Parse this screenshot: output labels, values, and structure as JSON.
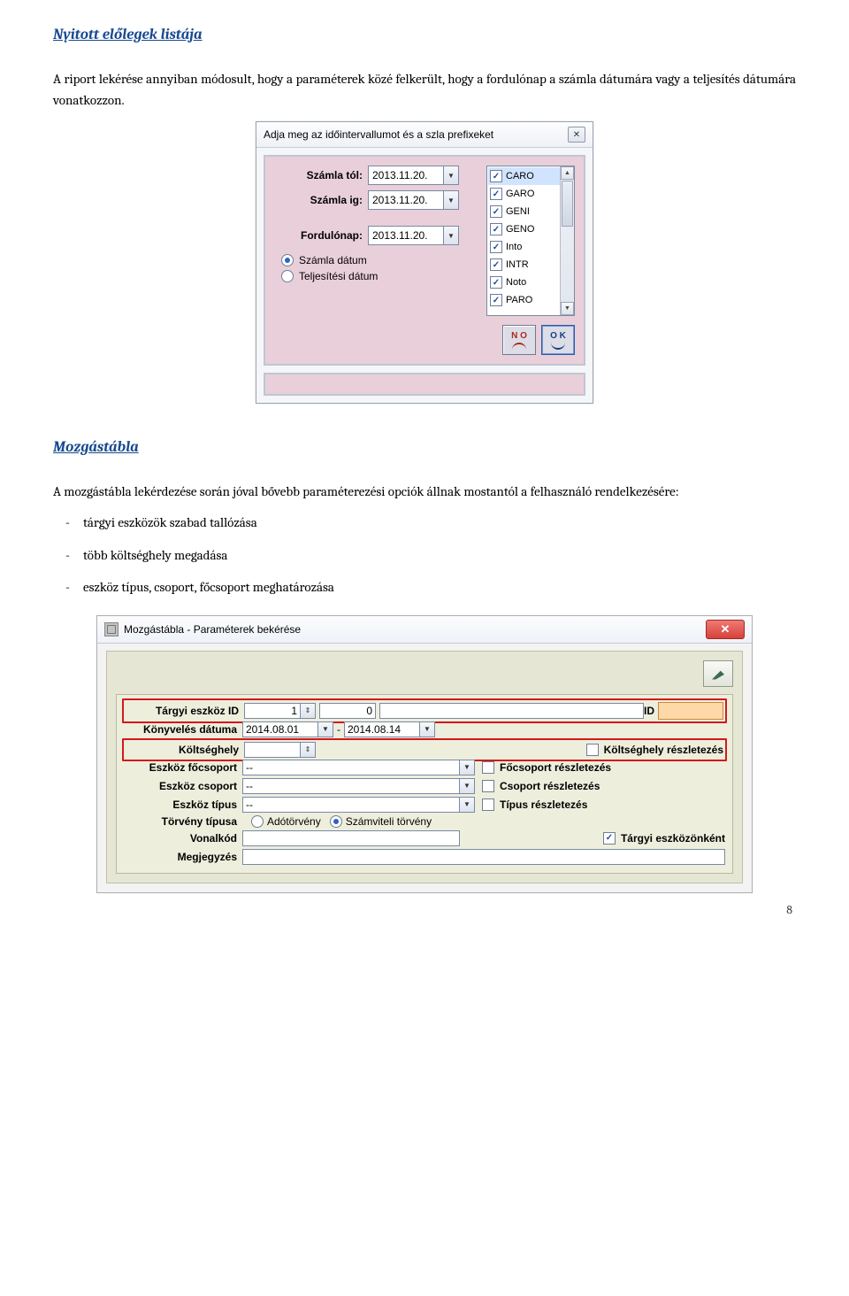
{
  "section1": {
    "title": "Nyitott előlegek listája",
    "paragraph": "A riport lekérése annyiban módosult, hogy a paraméterek közé felkerült, hogy a fordulónap a számla dátumára vagy a teljesítés dátumára vonatkozzon."
  },
  "dialog1": {
    "title": "Adja meg az időintervallumot és a szla prefixeket",
    "labels": {
      "from": "Számla tól:",
      "to": "Számla ig:",
      "turn": "Fordulónap:"
    },
    "values": {
      "date": "2013.11.20."
    },
    "radios": {
      "invoice_date": "Számla dátum",
      "perform_date": "Teljesítési dátum"
    },
    "prefixes": [
      "CARO",
      "GARO",
      "GENI",
      "GENO",
      "Into",
      "INTR",
      "Noto",
      "PARO"
    ],
    "buttons": {
      "no": "N O",
      "ok": "O K"
    }
  },
  "section2": {
    "title": "Mozgástábla",
    "paragraph": "A mozgástábla lekérdezése során jóval bővebb paraméterezési opciók állnak mostantól a felhasználó rendelkezésére:",
    "bullets": [
      "tárgyi eszközök szabad tallózása",
      "több költséghely megadása",
      "eszköz típus, csoport, főcsoport meghatározása"
    ]
  },
  "dialog2": {
    "title": "Mozgástábla - Paraméterek bekérése",
    "labels": {
      "asset_id": "Tárgyi eszköz ID",
      "booking_date": "Könyvelés dátuma",
      "cost_center": "Költséghely",
      "maingroup": "Eszköz főcsoport",
      "group": "Eszköz csoport",
      "type": "Eszköz típus",
      "lawtype": "Törvény típusa",
      "barcode": "Vonalkód",
      "note": "Megjegyzés",
      "id": "ID"
    },
    "values": {
      "asset_from": "1",
      "asset_to": "0",
      "date_from": "2014.08.01",
      "date_to": "2014.08.14",
      "dash": "--"
    },
    "radios": {
      "tax_law": "Adótörvény",
      "account_law": "Számviteli törvény"
    },
    "checks": {
      "cost_detail": "Költséghely részletezés",
      "main_detail": "Főcsoport részletezés",
      "group_detail": "Csoport részletezés",
      "type_detail": "Típus részletezés",
      "per_asset": "Tárgyi eszközönként"
    }
  },
  "page_number": "8"
}
